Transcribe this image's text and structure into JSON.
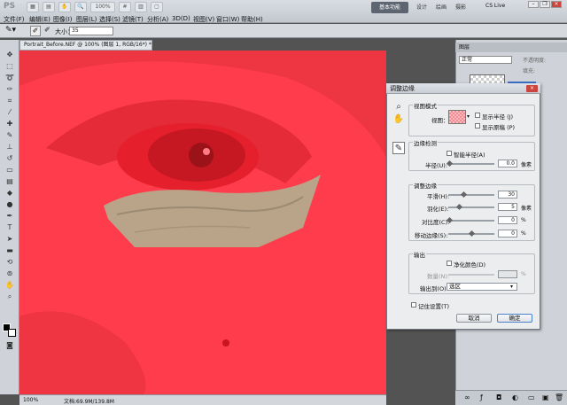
{
  "titlebar": {
    "logo": "PS",
    "zoom_pct": "100%",
    "workspace_button": "基本功能",
    "ws_items": [
      "设计",
      "绘画",
      "摄影"
    ],
    "cslive": "CS Live"
  },
  "menu": [
    "文件(F)",
    "编辑(E)",
    "图像(I)",
    "图层(L)",
    "选择(S)",
    "滤镜(T)",
    "分析(A)",
    "3D(D)",
    "视图(V)",
    "窗口(W)",
    "帮助(H)"
  ],
  "options": {
    "size_label": "大小：",
    "size_value": "35"
  },
  "document": {
    "tab_title": "Portrait_Before.NEF @ 100% (图层 1, RGB/16*) *",
    "status_zoom": "100%",
    "status_doc": "文档:69.9M/139.8M"
  },
  "layers_panel": {
    "title": "图层",
    "blend_mode": "正常",
    "opacity_label": "不透明度:",
    "fill_label": "填充:"
  },
  "dialog": {
    "title": "调整边缘",
    "view_mode": {
      "group": "视图模式",
      "view_label": "视图：",
      "show_radius": "显示半径 (J)",
      "show_original": "显示原稿 (P)"
    },
    "edge_detect": {
      "group": "边缘检测",
      "smart_radius": "智能半径(A)",
      "radius_label": "半径(U):",
      "radius_value": "0.0",
      "radius_unit": "像素"
    },
    "adjust": {
      "group": "调整边缘",
      "smooth_label": "平滑(H):",
      "smooth_value": "30",
      "feather_label": "羽化(E):",
      "feather_value": "5",
      "feather_unit": "像素",
      "contrast_label": "对比度(C):",
      "contrast_value": "0",
      "contrast_unit": "%",
      "shift_label": "移动边缘(S):",
      "shift_value": "0",
      "shift_unit": "%"
    },
    "output": {
      "group": "输出",
      "decontam": "净化颜色(D)",
      "amount_label": "数量(N):",
      "amount_unit": "%",
      "output_to_label": "输出到(O):",
      "output_to_value": "选区"
    },
    "remember": "记住设置(T)",
    "cancel": "取消",
    "ok": "确定"
  },
  "colors": {
    "overlay": "#ff3c4c",
    "skin_patch": "#b9a48a"
  }
}
